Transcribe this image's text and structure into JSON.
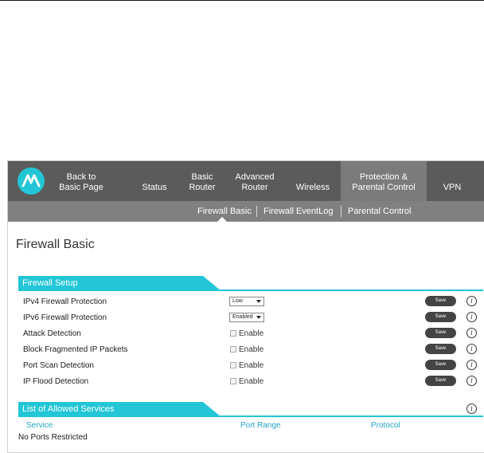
{
  "nav": {
    "items": [
      {
        "line1": "Back to",
        "line2": "Basic Page"
      },
      {
        "line1": "",
        "line2": "Status"
      },
      {
        "line1": "Basic",
        "line2": "Router"
      },
      {
        "line1": "Advanced",
        "line2": "Router"
      },
      {
        "line1": "",
        "line2": "Wireless"
      },
      {
        "line1": "Protection &",
        "line2": "Parental Control"
      },
      {
        "line1": "",
        "line2": "VPN"
      }
    ],
    "active_index": 5
  },
  "subnav": {
    "items": [
      "Firewall Basic",
      "Firewall EventLog",
      "Parental Control"
    ],
    "active_index": 0
  },
  "page_title": "Firewall Basic",
  "firewall_setup": {
    "title": "Firewall Setup",
    "save_label": "Save",
    "info_glyph": "i",
    "enable_label": "Enable",
    "rows": [
      {
        "label": "IPv4 Firewall Protection",
        "control": "select",
        "value": "Low"
      },
      {
        "label": "IPv6 Firewall Protection",
        "control": "select",
        "value": "Enabled"
      },
      {
        "label": "Attack Detection",
        "control": "checkbox",
        "checked": false
      },
      {
        "label": "Block Fragmented IP Packets",
        "control": "checkbox",
        "checked": false
      },
      {
        "label": "Port Scan Detection",
        "control": "checkbox",
        "checked": false
      },
      {
        "label": "IP Flood Detection",
        "control": "checkbox",
        "checked": false
      }
    ]
  },
  "allowed_services": {
    "title": "List of Allowed Services",
    "columns": [
      "Service",
      "Port Range",
      "Protocol"
    ],
    "empty_text": "No Ports Restricted"
  },
  "colors": {
    "accent": "#22c6d6",
    "nav_bg": "#5b5b5b",
    "nav_active": "#7b7b7b",
    "subnav_bg": "#808080",
    "button": "#444444"
  }
}
